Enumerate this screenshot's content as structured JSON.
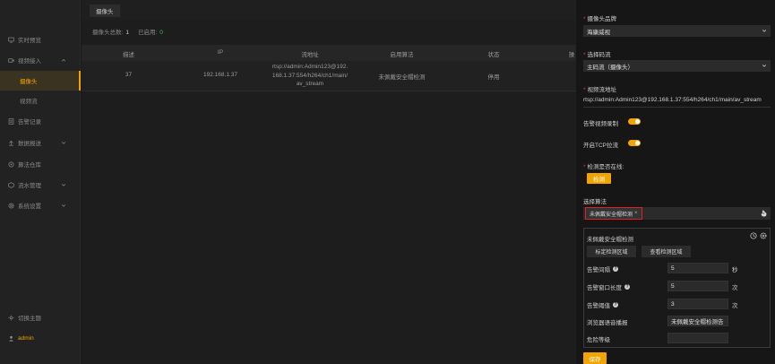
{
  "sidebar": {
    "items": [
      {
        "label": "实时预览",
        "icon": "monitor-icon"
      },
      {
        "label": "视频接入",
        "icon": "video-icon"
      },
      {
        "label": "摄像头",
        "icon": ""
      },
      {
        "label": "视频流",
        "icon": ""
      },
      {
        "label": "告警记录",
        "icon": "record-icon"
      },
      {
        "label": "数据报送",
        "icon": "upload-icon"
      },
      {
        "label": "算法仓库",
        "icon": "warehouse-icon"
      },
      {
        "label": "流水管理",
        "icon": "flow-icon"
      },
      {
        "label": "系统设置",
        "icon": "gear-icon"
      }
    ],
    "theme_label": "切换主题",
    "user_label": "admin"
  },
  "main": {
    "tab_label": "摄像头",
    "summary": {
      "total_label": "摄像头总数:",
      "total_value": "1",
      "enabled_label": "已启用:",
      "enabled_value": "0"
    },
    "columns": [
      "描述",
      "IP",
      "流地址",
      "启用算法",
      "状态",
      "操"
    ],
    "rows": [
      {
        "desc": "37",
        "ip": "192.168.1.37",
        "url_line1": "rtsp://admin:Admin123@192.",
        "url_line2": "168.1.37:554/h264/ch1/main/",
        "url_line3": "av_stream",
        "algo": "未佩戴安全帽检测",
        "status": "停用"
      }
    ]
  },
  "panel": {
    "brand_label": "摄像头品牌",
    "brand_value": "海康威视",
    "stream_select_label": "选择码流",
    "stream_select_value": "主码流（摄像头）",
    "stream_url_label": "视频流地址",
    "stream_url_value": "rtsp://admin:Admin123@192.168.1.37:554/h264/ch1/main/av_stream",
    "alarm_record_label": "告警视频录制",
    "tcp_label": "开启TCP拉流",
    "online_label": "检测是否在线:",
    "detect_button": "检测",
    "algo_label": "选择算法",
    "algo_chip": "未佩戴安全帽检测",
    "algo_chip_close": "×",
    "card": {
      "title": "未佩戴安全帽检测",
      "mark_region_button": "标定检测区域",
      "view_region_button": "查看检测区域",
      "interval_label": "告警间隔",
      "interval_value": "5",
      "interval_unit": "秒",
      "window_label": "告警窗口长度",
      "window_value": "5",
      "window_unit": "次",
      "threshold_label": "告警阈值",
      "threshold_value": "3",
      "threshold_unit": "次",
      "voice_label": "浏览器语音播报",
      "voice_value": "未佩戴安全帽检测告",
      "danger_label": "危险等级",
      "danger_value": ""
    },
    "save_button": "保存"
  },
  "colors": {
    "accent": "#f2a500",
    "required": "#e04040",
    "enabled_green": "#34c06a",
    "chip_border": "#e02020"
  }
}
